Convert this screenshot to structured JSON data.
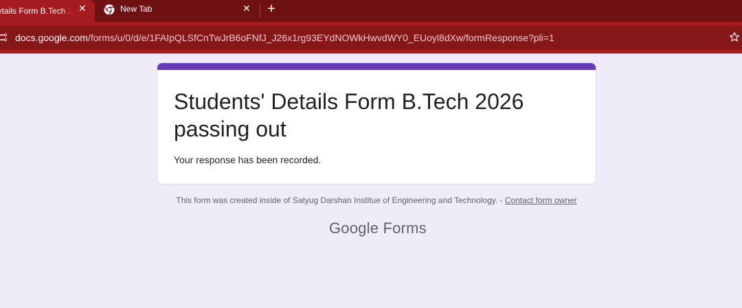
{
  "browser": {
    "tabs": [
      {
        "title": "etails Form B.Tech 20",
        "active": true,
        "close": "✕"
      },
      {
        "title": "New Tab",
        "active": false,
        "close": "✕"
      }
    ],
    "new_tab": "+",
    "url_host": "docs.google.com",
    "url_path": "/forms/u/0/d/e/1FAIpQLSfCnTwJrB6oFNfJ_J26x1rg93EYdNOWkHwvdWY0_EUoyl8dXw/formResponse?pli=1",
    "colors": {
      "tabstrip": "#6f1012",
      "active_tab": "#a51c20",
      "omnibox": "#861719"
    }
  },
  "form": {
    "title": "Students' Details Form B.Tech 2026 passing out",
    "confirmation": "Your response has been recorded.",
    "accent_color": "#673ab7"
  },
  "footer": {
    "note": "This form was created inside of Satyug Darshan Institue of Engineering and Technology. - ",
    "contact_link": "Contact form owner",
    "brand_google": "Google",
    "brand_forms": "Forms"
  }
}
